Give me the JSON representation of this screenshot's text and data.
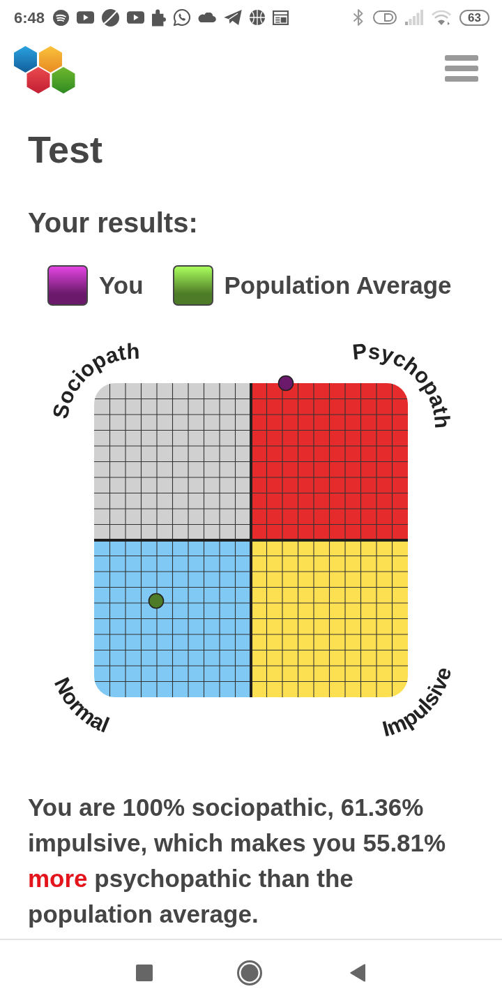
{
  "status_bar": {
    "time": "6:48",
    "battery": "63"
  },
  "page": {
    "title": "Test",
    "results_heading": "Your results:"
  },
  "legend": [
    {
      "label": "You",
      "color": "#6b1a6b"
    },
    {
      "label": "Population Average",
      "color": "#4e7b27"
    }
  ],
  "chart": {
    "corner_labels": {
      "top_left": "Sociopath",
      "top_right": "Psychopath",
      "bottom_left": "Normal",
      "bottom_right": "Impulsive"
    }
  },
  "result_text": [
    {
      "text": "You are 100% sociopathic, 61.36% impulsive, which makes you 55.81%",
      "highlight": false
    },
    {
      "text": "more",
      "highlight": true
    },
    {
      "text": "psychopathic than the population average.",
      "highlight": false
    }
  ]
}
